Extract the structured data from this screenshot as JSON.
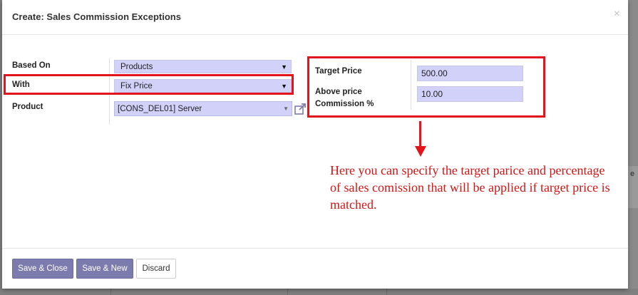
{
  "background": {
    "right_text": "e"
  },
  "dialog": {
    "title": "Create: Sales Commission Exceptions",
    "close_symbol": "×"
  },
  "form": {
    "based_on": {
      "label": "Based On",
      "value": "Products"
    },
    "with": {
      "label": "With",
      "value": "Fix Price"
    },
    "product": {
      "label": "Product",
      "value": "[CONS_DEL01] Server"
    },
    "target_price": {
      "label": "Target Price",
      "value": "500.00"
    },
    "above_price_commission": {
      "label_line1": "Above price",
      "label_line2": "Commission %",
      "value": "10.00"
    }
  },
  "annotation": {
    "text": "Here you can specify the target parice and percentage of sales comission that will be applied if target price is matched.",
    "color": "#d11515"
  },
  "footer": {
    "save_close": "Save & Close",
    "save_new": "Save & New",
    "discard": "Discard"
  },
  "colors": {
    "highlight_box": "#e3141b",
    "primary_button": "#7c7bad",
    "field_background": "#d1d1fa"
  }
}
